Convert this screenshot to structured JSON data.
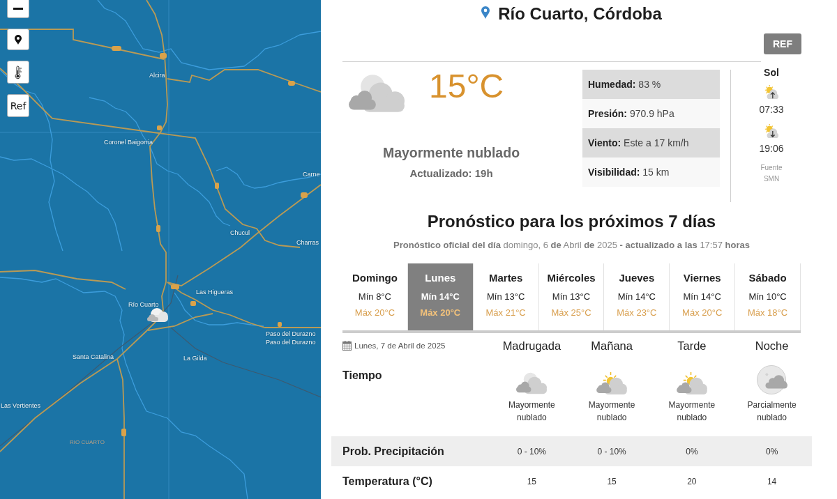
{
  "map": {
    "controls": [
      {
        "kind": "zoom_out"
      },
      {
        "kind": "locate"
      },
      {
        "kind": "temperature"
      },
      {
        "kind": "text",
        "label": "Ref"
      }
    ],
    "places": [
      {
        "name": "Alcira",
        "kind": "town"
      },
      {
        "name": "Coronel Baigorria",
        "kind": "town"
      },
      {
        "name": "Carne",
        "kind": "town"
      },
      {
        "name": "Chucul",
        "kind": "town"
      },
      {
        "name": "Charras",
        "kind": "town"
      },
      {
        "name": "Las Higueras",
        "kind": "town"
      },
      {
        "name": "Río Cuarto",
        "kind": "town"
      },
      {
        "name": "Paso del Durazno",
        "kind": "town"
      },
      {
        "name": "Paso del Durazno",
        "kind": "town"
      },
      {
        "name": "Santa Catalina",
        "kind": "town"
      },
      {
        "name": "La Gilda",
        "kind": "town"
      },
      {
        "name": "Las Vertientes",
        "kind": "town"
      },
      {
        "name": "RIO CUARTO",
        "kind": "region"
      }
    ]
  },
  "header": {
    "location": "Río Cuarto, Córdoba",
    "ref_button": "REF"
  },
  "current": {
    "temperature": "15°C",
    "condition": "Mayormente nublado",
    "updated": "Actualizado: 19h",
    "details": [
      {
        "label": "Humedad:",
        "value": "83 %"
      },
      {
        "label": "Presión:",
        "value": "970.9 hPa"
      },
      {
        "label": "Viento:",
        "value": "Este a 17 km/h"
      },
      {
        "label": "Visibilidad:",
        "value": "15 km"
      }
    ]
  },
  "sun": {
    "title": "Sol",
    "sunrise": "07:33",
    "sunset": "19:06",
    "source_label": "Fuente",
    "source": "SMN"
  },
  "forecast": {
    "title": "Pronóstico para los próximos 7 días",
    "subtitle": "**Pronóstico oficial del día** domingo, 6 **de** Abril **de** 2025 **- actualizado a las** 17:57 **horas**",
    "days": [
      {
        "name": "Domingo",
        "min": "Mín 8°C",
        "max": "Máx 20°C",
        "selected": false
      },
      {
        "name": "Lunes",
        "min": "Mín 14°C",
        "max": "Máx 20°C",
        "selected": true
      },
      {
        "name": "Martes",
        "min": "Mín 13°C",
        "max": "Máx 21°C",
        "selected": false
      },
      {
        "name": "Miércoles",
        "min": "Mín 13°C",
        "max": "Máx 25°C",
        "selected": false
      },
      {
        "name": "Jueves",
        "min": "Mín 14°C",
        "max": "Máx 23°C",
        "selected": false
      },
      {
        "name": "Viernes",
        "min": "Mín 14°C",
        "max": "Máx 20°C",
        "selected": false
      },
      {
        "name": "Sábado",
        "min": "Mín 10°C",
        "max": "Máx 18°C",
        "selected": false
      }
    ]
  },
  "day_detail": {
    "date": "Lunes, 7 de Abril de 2025",
    "weather_label": "Tiempo",
    "precipitation_label": "Prob. Precipitación",
    "temperature_label": "Temperatura (°C)",
    "periods": [
      {
        "name": "Madrugada",
        "condition": "Mayormente nublado",
        "precipitation": "0 - 10%",
        "temperature": "15"
      },
      {
        "name": "Mañana",
        "condition": "Mayormente nublado",
        "precipitation": "0 - 10%",
        "temperature": "15"
      },
      {
        "name": "Tarde",
        "condition": "Mayormente nublado",
        "precipitation": "0%",
        "temperature": "20"
      },
      {
        "name": "Noche",
        "condition": "Parcialmente nublado",
        "precipitation": "0%",
        "temperature": "14"
      }
    ]
  }
}
